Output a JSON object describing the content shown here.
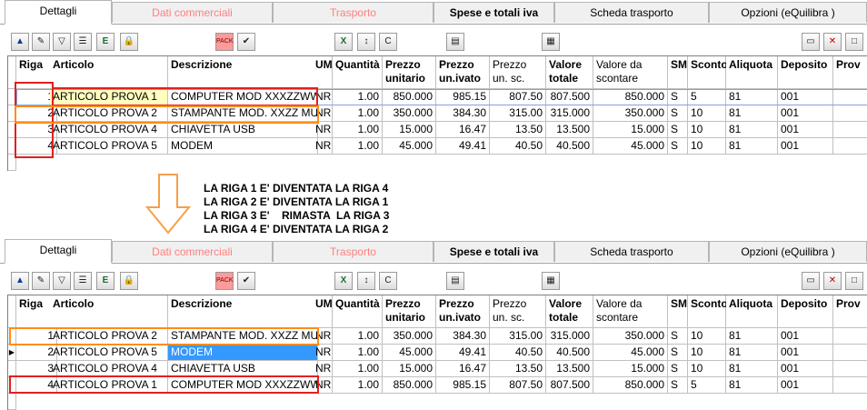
{
  "tabs": [
    {
      "label": "Dettagli",
      "active": true,
      "style": "normal"
    },
    {
      "label": "Dati commerciali",
      "active": false,
      "style": "red"
    },
    {
      "label": "Trasporto",
      "active": false,
      "style": "red"
    },
    {
      "label": "Spese e totali iva",
      "active": false,
      "style": "bold"
    },
    {
      "label": "Scheda trasporto",
      "active": false,
      "style": "normal"
    },
    {
      "label": "Opzioni (eQuilibra )",
      "active": false,
      "style": "normal"
    }
  ],
  "toolbar": {
    "pack_label": "PACK",
    "icons": [
      "move-up-icon",
      "edit-check-icon",
      "filter-icon",
      "list-icon",
      "excel-export-icon",
      "lock-icon",
      "pack-icon",
      "save-edit-icon",
      "excel-icon",
      "sort-az-icon",
      "copy-icon",
      "notepad-icon",
      "calculator-icon",
      "window-icon",
      "close-icon",
      "new-document-icon"
    ]
  },
  "columns": [
    {
      "key": "riga",
      "label": "Riga",
      "bold": true
    },
    {
      "key": "articolo",
      "label": "Articolo",
      "bold": true
    },
    {
      "key": "descrizione",
      "label": "Descrizione",
      "bold": true
    },
    {
      "key": "um",
      "label": "UM",
      "bold": true
    },
    {
      "key": "quantita",
      "label": "Quantità",
      "bold": true
    },
    {
      "key": "prezzo",
      "label": "Prezzo unitario",
      "bold": true
    },
    {
      "key": "prezzo_ivato",
      "label": "Prezzo un.ivato",
      "bold": true
    },
    {
      "key": "prezzo_sc",
      "label": "Prezzo un. sc.",
      "bold": false
    },
    {
      "key": "valore_totale",
      "label": "Valore totale",
      "bold": true
    },
    {
      "key": "valore_scontare",
      "label": "Valore da scontare",
      "bold": false
    },
    {
      "key": "sm",
      "label": "SM",
      "bold": true
    },
    {
      "key": "sconto",
      "label": "Sconto",
      "bold": true
    },
    {
      "key": "aliquota",
      "label": "Aliquota",
      "bold": true
    },
    {
      "key": "deposito",
      "label": "Deposito",
      "bold": true
    },
    {
      "key": "prov",
      "label": "Prov",
      "bold": true
    }
  ],
  "grid_before": [
    {
      "riga": "1",
      "articolo": "ARTICOLO PROVA 1",
      "descrizione": "COMPUTER MOD XXXZZWW",
      "um": "NR",
      "quantita": "1.00",
      "prezzo": "850.000",
      "prezzo_ivato": "985.15",
      "prezzo_sc": "807.50",
      "valore_totale": "807.500",
      "valore_scontare": "850.000",
      "sm": "S",
      "sconto": "5",
      "aliquota": "81",
      "deposito": "001",
      "prov": ""
    },
    {
      "riga": "2",
      "articolo": "ARTICOLO PROVA 2",
      "descrizione": "STAMPANTE MOD. XXZZ MU",
      "um": "NR",
      "quantita": "1.00",
      "prezzo": "350.000",
      "prezzo_ivato": "384.30",
      "prezzo_sc": "315.00",
      "valore_totale": "315.000",
      "valore_scontare": "350.000",
      "sm": "S",
      "sconto": "10",
      "aliquota": "81",
      "deposito": "001",
      "prov": ""
    },
    {
      "riga": "3",
      "articolo": "ARTICOLO PROVA 4",
      "descrizione": "CHIAVETTA USB",
      "um": "NR",
      "quantita": "1.00",
      "prezzo": "15.000",
      "prezzo_ivato": "16.47",
      "prezzo_sc": "13.50",
      "valore_totale": "13.500",
      "valore_scontare": "15.000",
      "sm": "S",
      "sconto": "10",
      "aliquota": "81",
      "deposito": "001",
      "prov": ""
    },
    {
      "riga": "4",
      "articolo": "ARTICOLO PROVA 5",
      "descrizione": "MODEM",
      "um": "NR",
      "quantita": "1.00",
      "prezzo": "45.000",
      "prezzo_ivato": "49.41",
      "prezzo_sc": "40.50",
      "valore_totale": "40.500",
      "valore_scontare": "45.000",
      "sm": "S",
      "sconto": "10",
      "aliquota": "81",
      "deposito": "001",
      "prov": ""
    }
  ],
  "grid_after": [
    {
      "riga": "1",
      "articolo": "ARTICOLO PROVA 2",
      "descrizione": "STAMPANTE MOD. XXZZ MU",
      "um": "NR",
      "quantita": "1.00",
      "prezzo": "350.000",
      "prezzo_ivato": "384.30",
      "prezzo_sc": "315.00",
      "valore_totale": "315.000",
      "valore_scontare": "350.000",
      "sm": "S",
      "sconto": "10",
      "aliquota": "81",
      "deposito": "001",
      "prov": ""
    },
    {
      "riga": "2",
      "articolo": "ARTICOLO PROVA 5",
      "descrizione": "MODEM",
      "um": "NR",
      "quantita": "1.00",
      "prezzo": "45.000",
      "prezzo_ivato": "49.41",
      "prezzo_sc": "40.50",
      "valore_totale": "40.500",
      "valore_scontare": "45.000",
      "sm": "S",
      "sconto": "10",
      "aliquota": "81",
      "deposito": "001",
      "prov": ""
    },
    {
      "riga": "3",
      "articolo": "ARTICOLO PROVA 4",
      "descrizione": "CHIAVETTA USB",
      "um": "NR",
      "quantita": "1.00",
      "prezzo": "15.000",
      "prezzo_ivato": "16.47",
      "prezzo_sc": "13.50",
      "valore_totale": "13.500",
      "valore_scontare": "15.000",
      "sm": "S",
      "sconto": "10",
      "aliquota": "81",
      "deposito": "001",
      "prov": ""
    },
    {
      "riga": "4",
      "articolo": "ARTICOLO PROVA 1",
      "descrizione": "COMPUTER MOD XXXZZWW",
      "um": "NR",
      "quantita": "1.00",
      "prezzo": "850.000",
      "prezzo_ivato": "985.15",
      "prezzo_sc": "807.50",
      "valore_totale": "807.500",
      "valore_scontare": "850.000",
      "sm": "S",
      "sconto": "5",
      "aliquota": "81",
      "deposito": "001",
      "prov": ""
    }
  ],
  "notes": [
    "LA RIGA 1 E' DIVENTATA LA RIGA 4",
    "LA RIGA 2 E' DIVENTATA LA RIGA 1",
    "LA RIGA 3 E'    RIMASTA  LA RIGA 3",
    "LA RIGA 4 E' DIVENTATA LA RIGA 2"
  ],
  "colors": {
    "highlight_red": "#e02020",
    "highlight_orange": "#ff8c1a",
    "selected_bg": "#3399ff",
    "edit_bg": "#ffffc0",
    "arrow": "#f5a04a"
  }
}
